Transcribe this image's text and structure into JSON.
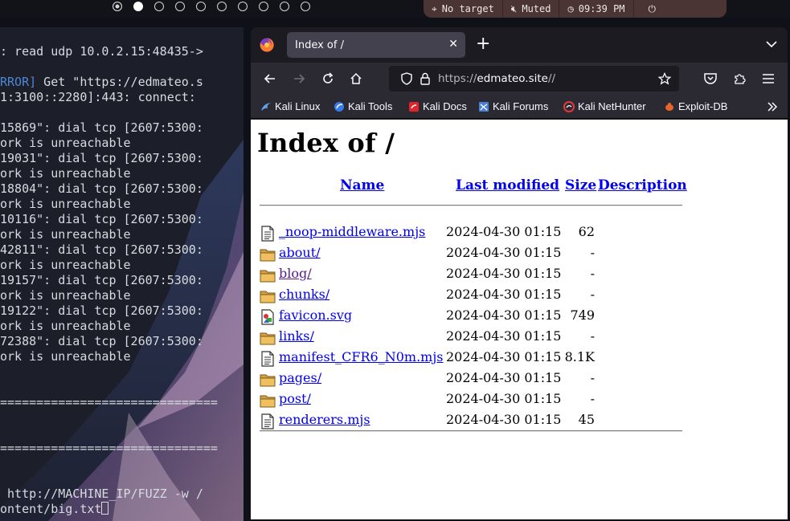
{
  "topbar": {
    "workspaces": 10,
    "active_workspace": 2,
    "target": "No target",
    "audio": "Muted",
    "clock": "09:39 PM"
  },
  "terminal": {
    "lines": [
      [
        ": read udp 10.0.2.15:48435->"
      ],
      [
        "",
        ""
      ],
      [
        "RROR]",
        " Get \"https://edmateo.s"
      ],
      [
        "1:3100::2280]:443: connect:"
      ],
      [
        ""
      ],
      [
        "15869\": dial tcp [2607:5300:"
      ],
      [
        "ork is unreachable"
      ],
      [
        "19031\": dial tcp [2607:5300:"
      ],
      [
        "ork is unreachable"
      ],
      [
        "18804\": dial tcp [2607:5300:"
      ],
      [
        "ork is unreachable"
      ],
      [
        "10116\": dial tcp [2607:5300:"
      ],
      [
        "ork is unreachable"
      ],
      [
        "42811\": dial tcp [2607:5300:"
      ],
      [
        "ork is unreachable"
      ],
      [
        "19157\": dial tcp [2607:5300:"
      ],
      [
        "ork is unreachable"
      ],
      [
        "19122\": dial tcp [2607:5300:"
      ],
      [
        "ork is unreachable"
      ],
      [
        "72388\": dial tcp [2607:5300:"
      ],
      [
        "ork is unreachable"
      ],
      [
        ""
      ],
      [
        ""
      ],
      [
        "=============================="
      ],
      [
        ""
      ],
      [
        ""
      ],
      [
        "=============================="
      ],
      [
        ""
      ],
      [
        ""
      ],
      [
        " http://MACHINE_IP/FUZZ -w /"
      ],
      [
        "ontent/big.txt"
      ]
    ]
  },
  "browser": {
    "tab_title": "Index of /",
    "url_scheme": "https://",
    "url_host": "edmateo.site",
    "url_path": "//",
    "bookmarks": [
      "Kali Linux",
      "Kali Tools",
      "Kali Docs",
      "Kali Forums",
      "Kali NetHunter",
      "Exploit-DB"
    ]
  },
  "page": {
    "title": "Index of /",
    "headers": {
      "name": "Name",
      "modified": "Last modified",
      "size": "Size",
      "description": "Description"
    },
    "entries": [
      {
        "name": "_noop-middleware.mjs",
        "modified": "2024-04-30 01:15",
        "size": "62",
        "kind": "file",
        "visited": false
      },
      {
        "name": "about/",
        "modified": "2024-04-30 01:15",
        "size": "-",
        "kind": "folder",
        "visited": false
      },
      {
        "name": "blog/",
        "modified": "2024-04-30 01:15",
        "size": "-",
        "kind": "folder",
        "visited": true
      },
      {
        "name": "chunks/",
        "modified": "2024-04-30 01:15",
        "size": "-",
        "kind": "folder",
        "visited": false
      },
      {
        "name": "favicon.svg",
        "modified": "2024-04-30 01:15",
        "size": "749",
        "kind": "image",
        "visited": false
      },
      {
        "name": "links/",
        "modified": "2024-04-30 01:15",
        "size": "-",
        "kind": "folder",
        "visited": false
      },
      {
        "name": "manifest_CFR6_N0m.mjs",
        "modified": "2024-04-30 01:15",
        "size": "8.1K",
        "kind": "file",
        "visited": false
      },
      {
        "name": "pages/",
        "modified": "2024-04-30 01:15",
        "size": "-",
        "kind": "folder",
        "visited": false
      },
      {
        "name": "post/",
        "modified": "2024-04-30 01:15",
        "size": "-",
        "kind": "folder",
        "visited": false
      },
      {
        "name": "renderers.mjs",
        "modified": "2024-04-30 01:15",
        "size": "45",
        "kind": "file",
        "visited": false
      }
    ]
  },
  "colors": {
    "link": "#0000ee",
    "visited_link": "#551a8b",
    "terminal_bg": "#1c1f29",
    "terminal_error": "#4d88d4",
    "status_pill": "#4b3434"
  }
}
